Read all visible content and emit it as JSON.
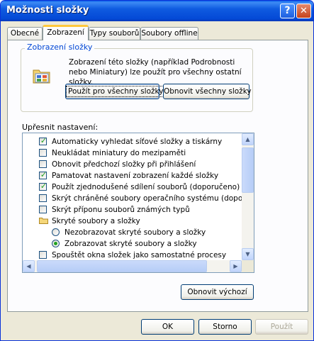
{
  "window": {
    "title": "Možnosti složky",
    "help_glyph": "?",
    "close_glyph": "✕"
  },
  "tabs": [
    {
      "label": "Obecné",
      "active": false
    },
    {
      "label": "Zobrazení",
      "active": true
    },
    {
      "label": "Typy souborů",
      "active": false
    },
    {
      "label": "Soubory offline",
      "active": false
    }
  ],
  "folder_views": {
    "legend": "Zobrazení složky",
    "description": "Zobrazení této složky (například Podrobnosti nebo Miniatury) lze použít pro všechny ostatní složky.",
    "apply_all_label": "Použít pro všechny složky",
    "reset_all_label": "Obnovit všechny složky"
  },
  "advanced": {
    "label": "Upřesnit nastavení:",
    "items": [
      {
        "type": "checkbox",
        "checked": true,
        "label": "Automaticky vyhledat síťové složky a tiskárny"
      },
      {
        "type": "checkbox",
        "checked": false,
        "label": "Neukládat miniatury do mezipaměti"
      },
      {
        "type": "checkbox",
        "checked": false,
        "label": "Obnovit předchozí složky při přihlášení"
      },
      {
        "type": "checkbox",
        "checked": true,
        "label": "Pamatovat nastavení zobrazení každé složky"
      },
      {
        "type": "checkbox",
        "checked": true,
        "label": "Použít zjednodušené sdílení souborů (doporučeno)"
      },
      {
        "type": "checkbox",
        "checked": false,
        "label": "Skrýt chráněné soubory operačního systému (doporučen"
      },
      {
        "type": "checkbox",
        "checked": false,
        "label": "Skrýt příponu souborů známých typů"
      },
      {
        "type": "folder",
        "label": "Skryté soubory a složky"
      },
      {
        "type": "radio",
        "checked": false,
        "label": "Nezobrazovat skryté soubory a složky"
      },
      {
        "type": "radio",
        "checked": true,
        "label": "Zobrazovat skryté soubory a složky"
      },
      {
        "type": "checkbox",
        "checked": false,
        "label": "Spouštět okna složek jako samostatné procesy"
      }
    ],
    "restore_defaults_label": "Obnovit výchozí"
  },
  "footer": {
    "ok_label": "OK",
    "cancel_label": "Storno",
    "apply_label": "Použít"
  },
  "colors": {
    "titlebar": "#0449D6",
    "dialog_bg": "#ECE9D8",
    "accent_legend": "#0046D5",
    "check_mark": "#21A121"
  }
}
